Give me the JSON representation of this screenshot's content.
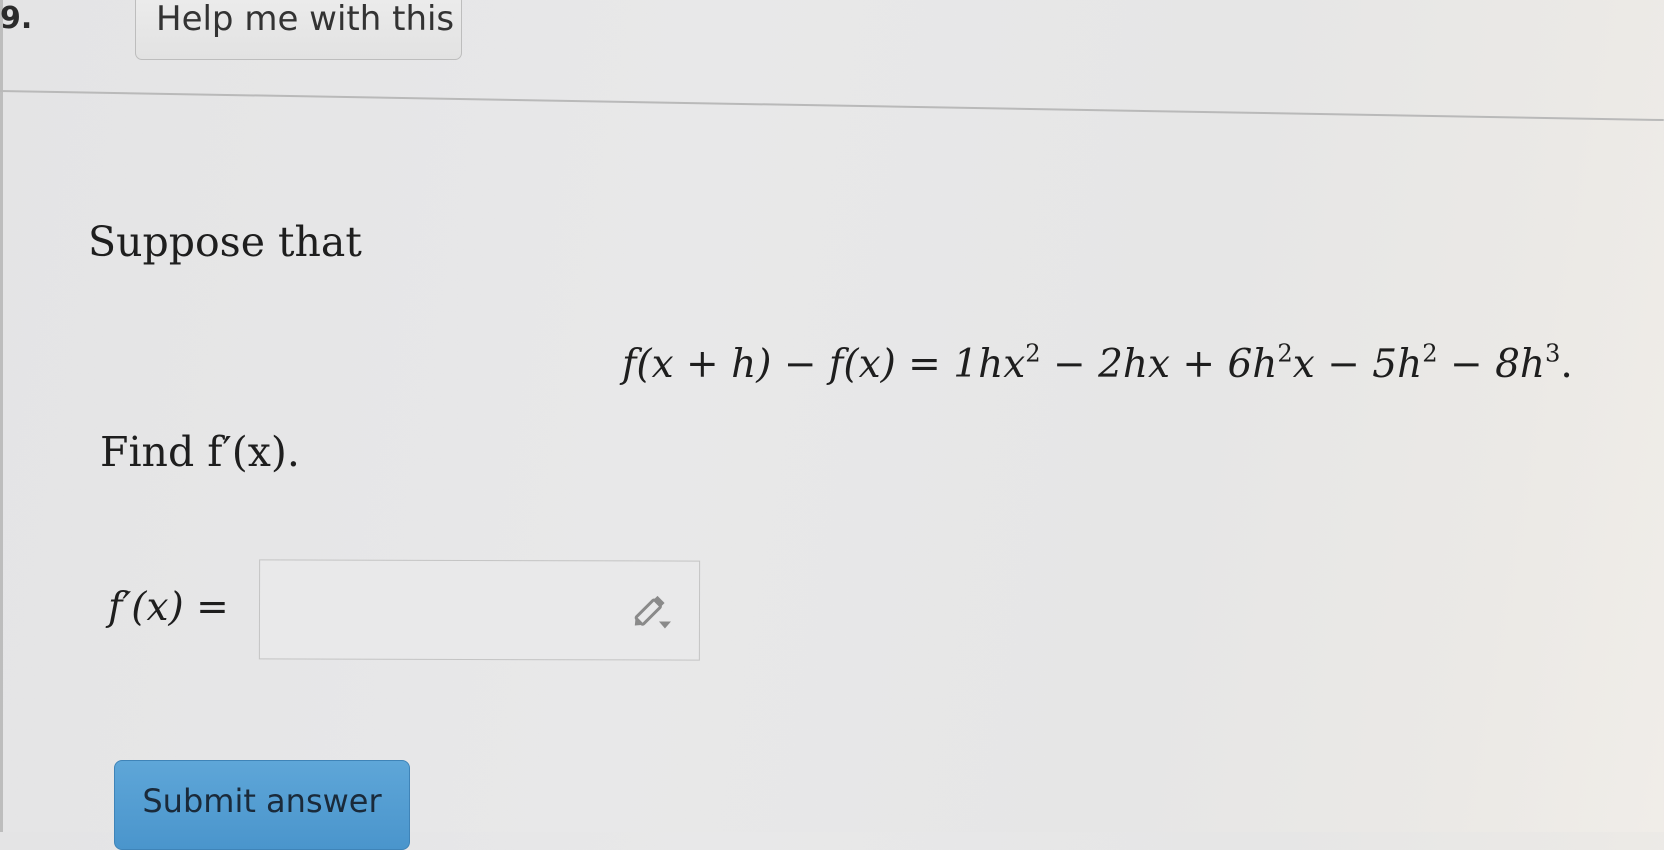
{
  "question": {
    "number": "9.",
    "help_button_label": "Help me with this",
    "prompt": "Suppose that",
    "equation": {
      "lhs": "f(x + h) − f(x) = ",
      "terms": [
        "1hx",
        "2",
        " − 2hx + 6h",
        "2",
        "x − 5h",
        "2",
        " − 8h",
        "3",
        "."
      ]
    },
    "find_text": "Find f′(x).",
    "answer_label": "f′(x) = ",
    "answer_value": "",
    "answer_placeholder": ""
  },
  "actions": {
    "submit_label": "Submit answer"
  },
  "icons": {
    "editor": "pencil-icon"
  },
  "colors": {
    "submit_button": "#4a95cc",
    "background": "#e6e6e6"
  }
}
